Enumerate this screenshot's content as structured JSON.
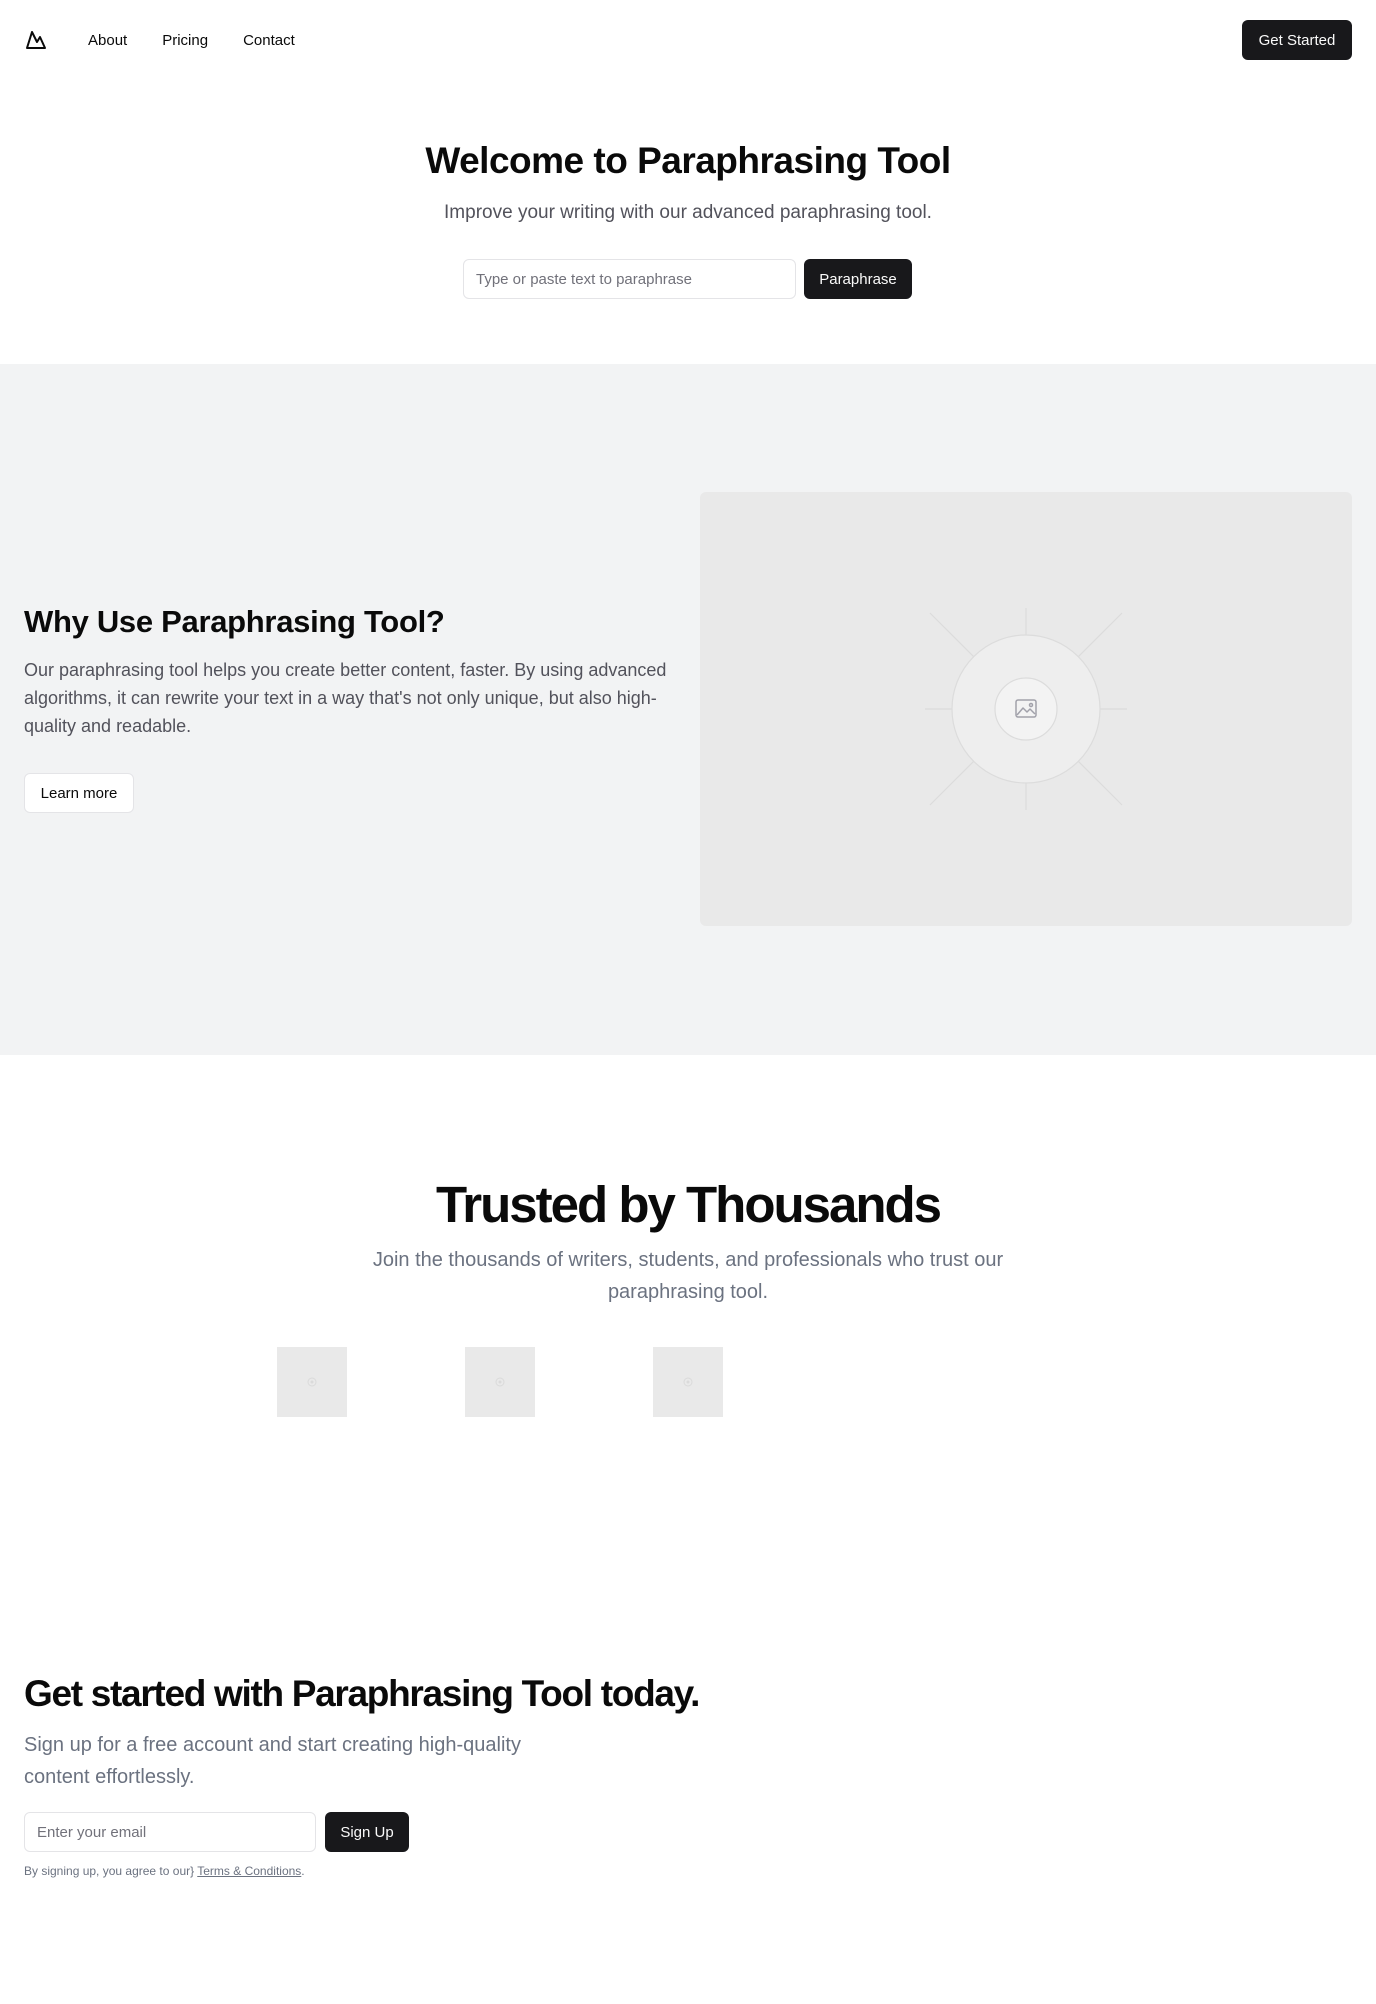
{
  "header": {
    "logo_icon": "mountain-icon",
    "nav": [
      {
        "label": "About"
      },
      {
        "label": "Pricing"
      },
      {
        "label": "Contact"
      }
    ],
    "cta_label": "Get Started"
  },
  "hero": {
    "title": "Welcome to Paraphrasing Tool",
    "subtitle": "Improve your writing with our advanced paraphrasing tool.",
    "input_placeholder": "Type or paste text to paraphrase",
    "button_label": "Paraphrase"
  },
  "features": {
    "title": "Why Use Paraphrasing Tool?",
    "description": "Our paraphrasing tool helps you create better content, faster. By using advanced algorithms, it can rewrite your text in a way that's not only unique, but also high-quality and readable.",
    "button_label": "Learn more",
    "image_icon": "image-placeholder-icon"
  },
  "trusted": {
    "title": "Trusted by Thousands",
    "subtitle": "Join the thousands of writers, students, and professionals who trust our paraphrasing tool.",
    "logo_count_visible": 3
  },
  "cta": {
    "title": "Get started with Paraphrasing Tool today.",
    "subtitle": "Sign up for a free account and start creating high-quality content effortlessly.",
    "email_placeholder": "Enter your email",
    "button_label": "Sign Up",
    "fineprint_prefix": "By signing up, you agree to our}",
    "terms_link": "Terms & Conditions",
    "fineprint_suffix": "."
  },
  "colors": {
    "primary_button": "#18181b",
    "section_bg": "#f2f3f4",
    "placeholder_bg": "#e9e9e9",
    "muted_text": "#6b7280"
  }
}
